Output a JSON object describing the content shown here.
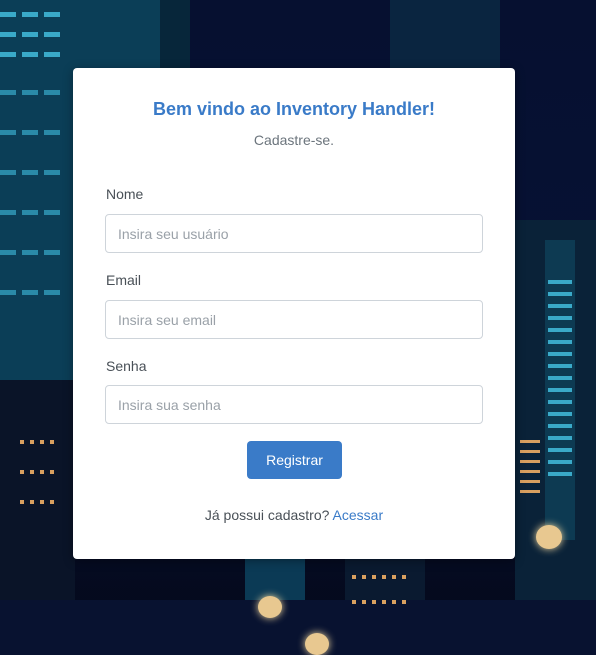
{
  "form": {
    "title": "Bem vindo ao Inventory Handler!",
    "subtitle": "Cadastre-se.",
    "fields": {
      "name": {
        "label": "Nome",
        "placeholder": "Insira seu usuário"
      },
      "email": {
        "label": "Email",
        "placeholder": "Insira seu email"
      },
      "password": {
        "label": "Senha",
        "placeholder": "Insira sua senha"
      }
    },
    "submit_label": "Registrar",
    "footer_text": "Já possui cadastro?",
    "footer_link": "Acessar"
  },
  "colors": {
    "accent": "#3a7bc8",
    "background": "#061030"
  }
}
